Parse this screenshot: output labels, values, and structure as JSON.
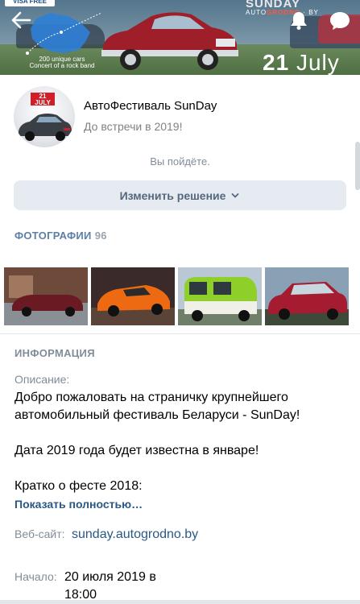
{
  "cover": {
    "visa_text": "VISA FREE",
    "map_caption_1": "200 unique cars",
    "map_caption_2": "Concert of a rock band",
    "logo_text": "SUNDAY",
    "logo_sub_1": "AUTO",
    "logo_sub_2": "GRODNO",
    "logo_sub_3": "BY",
    "date_day": "21",
    "date_month": "July"
  },
  "header": {
    "back_icon": "arrow-left-icon",
    "bell_icon": "bell-icon",
    "chat_icon": "chat-bubble-icon"
  },
  "event": {
    "avatar_ribbon_1": "21",
    "avatar_ribbon_2": "JULY",
    "title": "АвтоФестиваль SunDay",
    "subtitle": "До встречи в 2019!",
    "going_status": "Вы пойдёте.",
    "change_button": "Изменить решение"
  },
  "photos": {
    "header": "ФОТОГРАФИИ",
    "count": "96"
  },
  "info": {
    "header": "ИНФОРМАЦИЯ",
    "description_label": "Описание:",
    "description_lines": [
      "Добро пожаловать на страничку крупнейшего автомобильный фестиваль Беларуси - SunDay!",
      "Дата 2019 года будет известна в январе!",
      "Кратко о фесте 2018:"
    ],
    "show_more": "Показать полностью…",
    "website_label": "Веб-сайт:",
    "website_value": "sunday.autogrodno.by",
    "start_label": "Начало:",
    "start_value": "20 июля 2019 в 18:00"
  },
  "colors": {
    "accent": "#2a5885",
    "secondary_text": "#818c99",
    "button_bg": "#e5ebf1",
    "button_text": "#55677d"
  }
}
